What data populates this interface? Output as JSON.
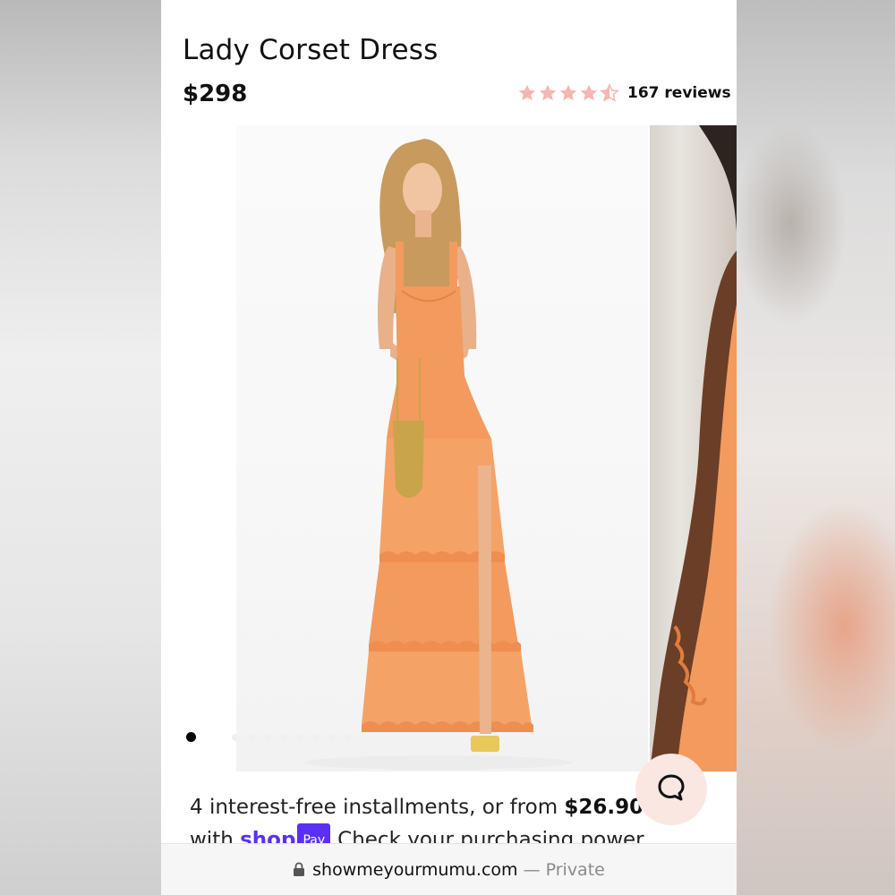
{
  "product": {
    "title": "Lady Corset Dress",
    "price": "$298",
    "rating_stars": 4.5,
    "reviews_label": "167 reviews"
  },
  "gallery": {
    "dot_count": 9,
    "active_index": 0
  },
  "installments": {
    "text_prefix": "4 interest-free installments, or from ",
    "amount": "$26.90",
    "text_with": "with ",
    "shoppay_brand": "shop",
    "shoppay_badge": "Pay",
    "cta_text": "Check your purchasing power"
  },
  "browser": {
    "domain": "showmeyourmumu.com",
    "privacy": "— Private"
  },
  "colors": {
    "star": "#f4b6b0",
    "shoppay": "#5a31f4",
    "dress": "#f39a5e",
    "chat_bg": "#fbe7e1"
  }
}
